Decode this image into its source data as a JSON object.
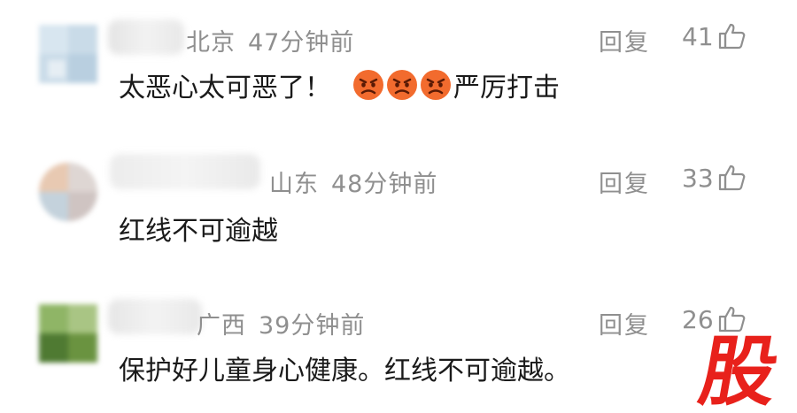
{
  "comments": [
    {
      "location": "北京",
      "time": "47分钟前",
      "reply_label": "回复",
      "likes": "41",
      "text_before": "太恶心太可恶了！",
      "emojis": [
        "angry-face",
        "angry-face",
        "angry-face"
      ],
      "text_after": "严厉打击"
    },
    {
      "location": "山东",
      "time": "48分钟前",
      "reply_label": "回复",
      "likes": "33",
      "text": "红线不可逾越"
    },
    {
      "location": "广西",
      "time": "39分钟前",
      "reply_label": "回复",
      "likes": "26",
      "text": "保护好儿童身心健康。红线不可逾越。"
    }
  ],
  "watermark": {
    "text": "股",
    "color": "#e8211b"
  },
  "colors": {
    "meta_text": "#8f8f8f",
    "body_text": "#1a1a1a",
    "emoji_face": "#f26b2e"
  }
}
